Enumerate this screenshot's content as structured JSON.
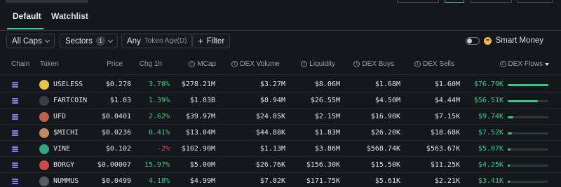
{
  "tabs": [
    {
      "label": "Default"
    },
    {
      "label": "Watchlist"
    }
  ],
  "filters": {
    "caps_label": "All Caps",
    "sectors_label": "Sectors",
    "sectors_count": "1",
    "token_age_value": "Any",
    "token_age_label": "Token Age(D)",
    "filter_label": "Filter",
    "smart_money_label": "Smart Money",
    "smart_money_on": false
  },
  "columns": {
    "chain": "Chain",
    "token": "Token",
    "price": "Price",
    "chg1h": "Chg 1h",
    "mcap": "MCap",
    "dex_volume": "DEX Volume",
    "liquidity": "Liquidity",
    "dex_buys": "DEX Buys",
    "dex_sells": "DEX Sells",
    "dex_flows": "DEX Flows"
  },
  "rows": [
    {
      "symbol": "USELESS",
      "price": "$0.278",
      "chg": "3.78%",
      "chg_dir": "up",
      "mcap": "$278.21M",
      "vol": "$3.27M",
      "liq": "$8.06M",
      "buys": "$1.68M",
      "sells": "$1.60M",
      "flow": "$76.79K",
      "flow_fraction": 1.0,
      "avatar_color": "#e8c44a"
    },
    {
      "symbol": "FARTCOIN",
      "price": "$1.03",
      "chg": "1.39%",
      "chg_dir": "up",
      "mcap": "$1.03B",
      "vol": "$8.94M",
      "liq": "$26.55M",
      "buys": "$4.50M",
      "sells": "$4.44M",
      "flow": "$56.51K",
      "flow_fraction": 0.74,
      "avatar_color": "#3a3f45"
    },
    {
      "symbol": "UFD",
      "price": "$0.0401",
      "chg": "2.62%",
      "chg_dir": "up",
      "mcap": "$39.97M",
      "vol": "$24.05K",
      "liq": "$2.15M",
      "buys": "$16.90K",
      "sells": "$7.15K",
      "flow": "$9.74K",
      "flow_fraction": 0.13,
      "avatar_color": "#c0604f"
    },
    {
      "symbol": "$MICHI",
      "price": "$0.0236",
      "chg": "0.41%",
      "chg_dir": "up",
      "mcap": "$13.04M",
      "vol": "$44.88K",
      "liq": "$1.83M",
      "buys": "$26.20K",
      "sells": "$18.68K",
      "flow": "$7.52K",
      "flow_fraction": 0.1,
      "avatar_color": "#c08a62"
    },
    {
      "symbol": "VINE",
      "price": "$0.102",
      "chg": "-2%",
      "chg_dir": "down",
      "mcap": "$102.90M",
      "vol": "$1.13M",
      "liq": "$3.86M",
      "buys": "$568.74K",
      "sells": "$563.67K",
      "flow": "$5.07K",
      "flow_fraction": 0.07,
      "avatar_color": "#2fa882"
    },
    {
      "symbol": "BORGY",
      "price": "$0.00007",
      "chg": "15.97%",
      "chg_dir": "up",
      "mcap": "$5.00M",
      "vol": "$26.76K",
      "liq": "$156.30K",
      "buys": "$15.50K",
      "sells": "$11.25K",
      "flow": "$4.25K",
      "flow_fraction": 0.055,
      "avatar_color": "#c84a4a"
    },
    {
      "symbol": "NUMMUS",
      "price": "$0.0499",
      "chg": "4.18%",
      "chg_dir": "up",
      "mcap": "$4.99M",
      "vol": "$7.82K",
      "liq": "$171.75K",
      "buys": "$5.61K",
      "sells": "$2.21K",
      "flow": "$3.41K",
      "flow_fraction": 0.045,
      "avatar_color": "#555b62"
    }
  ],
  "colors": {
    "accent": "#3fce89",
    "negative": "#ef4d5f",
    "background": "#14181d",
    "chain_icon": "#8a7df0"
  },
  "icons": {
    "chain": "solana-icon",
    "filter": "plus-icon",
    "info": "info-circle-icon",
    "sort": "sort-desc-icon",
    "smart_money": "smiley-icon"
  }
}
